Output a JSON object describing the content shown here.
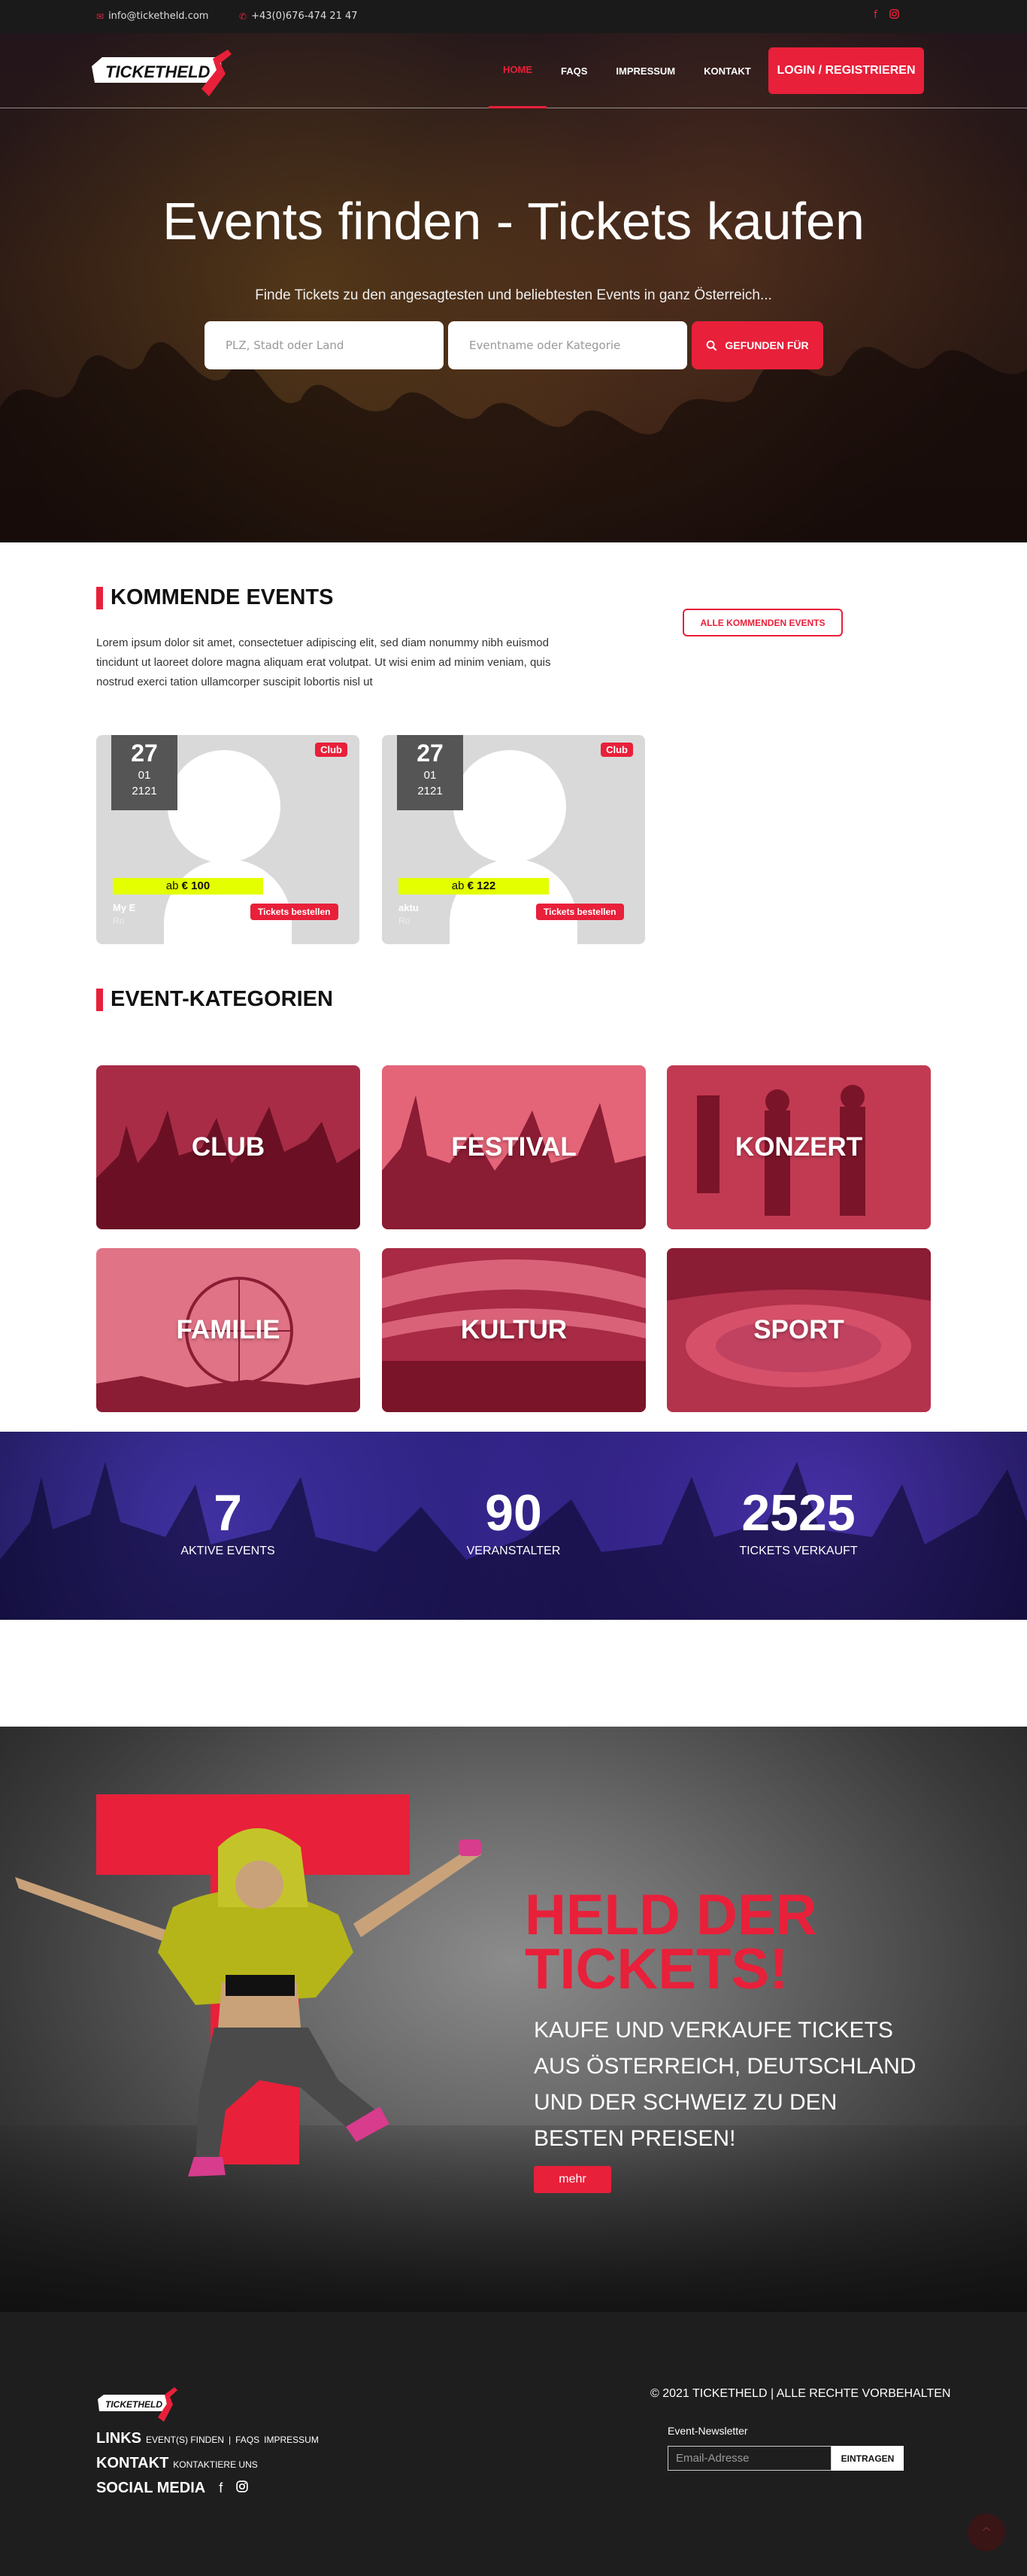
{
  "topbar": {
    "email": "info@ticketheld.com",
    "phone": "+43(0)676-474 21 47",
    "email_icon": "envelope-icon",
    "phone_icon": "phone-icon",
    "social": [
      "facebook-icon",
      "instagram-icon"
    ]
  },
  "nav": {
    "logo_text": "TICKETHELD",
    "items": [
      {
        "label": "HOME",
        "active": true
      },
      {
        "label": "FAQS",
        "active": false
      },
      {
        "label": "IMPRESSUM",
        "active": false
      },
      {
        "label": "KONTAKT",
        "active": false
      }
    ],
    "login_label": "LOGIN / REGISTRIEREN"
  },
  "hero": {
    "title": "Events finden - Tickets kaufen",
    "subtitle": "Finde Tickets zu den angesagtesten und beliebtesten Events in ganz Österreich...",
    "location_placeholder": "PLZ, Stadt oder Land",
    "event_placeholder": "Eventname oder Kategorie",
    "search_label": "GEFUNDEN FÜR"
  },
  "upcoming": {
    "heading": "KOMMENDE EVENTS",
    "text": "Lorem ipsum dolor sit amet, consectetuer adipiscing elit, sed diam nonummy nibh euismod tincidunt ut laoreet dolore magna aliquam erat volutpat. Ut wisi enim ad minim veniam, quis nostrud exerci tation ullamcorper suscipit lobortis nisl ut",
    "all_label": "ALLE KOMMENDEN EVENTS",
    "events": [
      {
        "day": "27",
        "month": "01",
        "year": "2121",
        "badge": "Club",
        "price_prefix": "ab",
        "price": "€ 100",
        "name": "My E",
        "location": "Ro",
        "order_label": "Tickets bestellen"
      },
      {
        "day": "27",
        "month": "01",
        "year": "2121",
        "badge": "Club",
        "price_prefix": "ab",
        "price": "€ 122",
        "name": "aktu",
        "location": "Ro",
        "order_label": "Tickets bestellen"
      }
    ]
  },
  "categories": {
    "heading": "EVENT-KATEGORIEN",
    "items": [
      "CLUB",
      "FESTIVAL",
      "KONZERT",
      "FAMILIE",
      "KULTUR",
      "SPORT"
    ]
  },
  "stats": [
    {
      "value": "7",
      "label": "AKTIVE EVENTS"
    },
    {
      "value": "90",
      "label": "VERANSTALTER"
    },
    {
      "value": "2525",
      "label": "TICKETS VERKAUFT"
    }
  ],
  "held": {
    "title_line1": "HELD DER",
    "title_line2": "TICKETS!",
    "text": "KAUFE UND VERKAUFE TICKETS AUS ÖSTERREICH, DEUTSCHLAND UND DER SCHWEIZ ZU DEN BESTEN PREISEN!",
    "more_label": "mehr"
  },
  "footer": {
    "logo_text": "TICKETHELD",
    "links_heading": "LINKS",
    "links": [
      "EVENT(S) FINDEN",
      "FAQS",
      "IMPRESSUM"
    ],
    "contact_heading": "KONTAKT",
    "contact_link": "KONTAKTIERE UNS",
    "social_heading": "SOCIAL MEDIA",
    "social": [
      "facebook-icon",
      "instagram-icon"
    ],
    "copyright": "© 2021 TICKETHELD | ALLE RECHTE VORBEHALTEN",
    "newsletter_label": "Event-Newsletter",
    "newsletter_placeholder": "Email-Adresse",
    "newsletter_button": "EINTRAGEN"
  },
  "colors": {
    "accent": "#e8203a",
    "price_highlight": "#e3ff00",
    "dark": "#1e1e1e"
  }
}
